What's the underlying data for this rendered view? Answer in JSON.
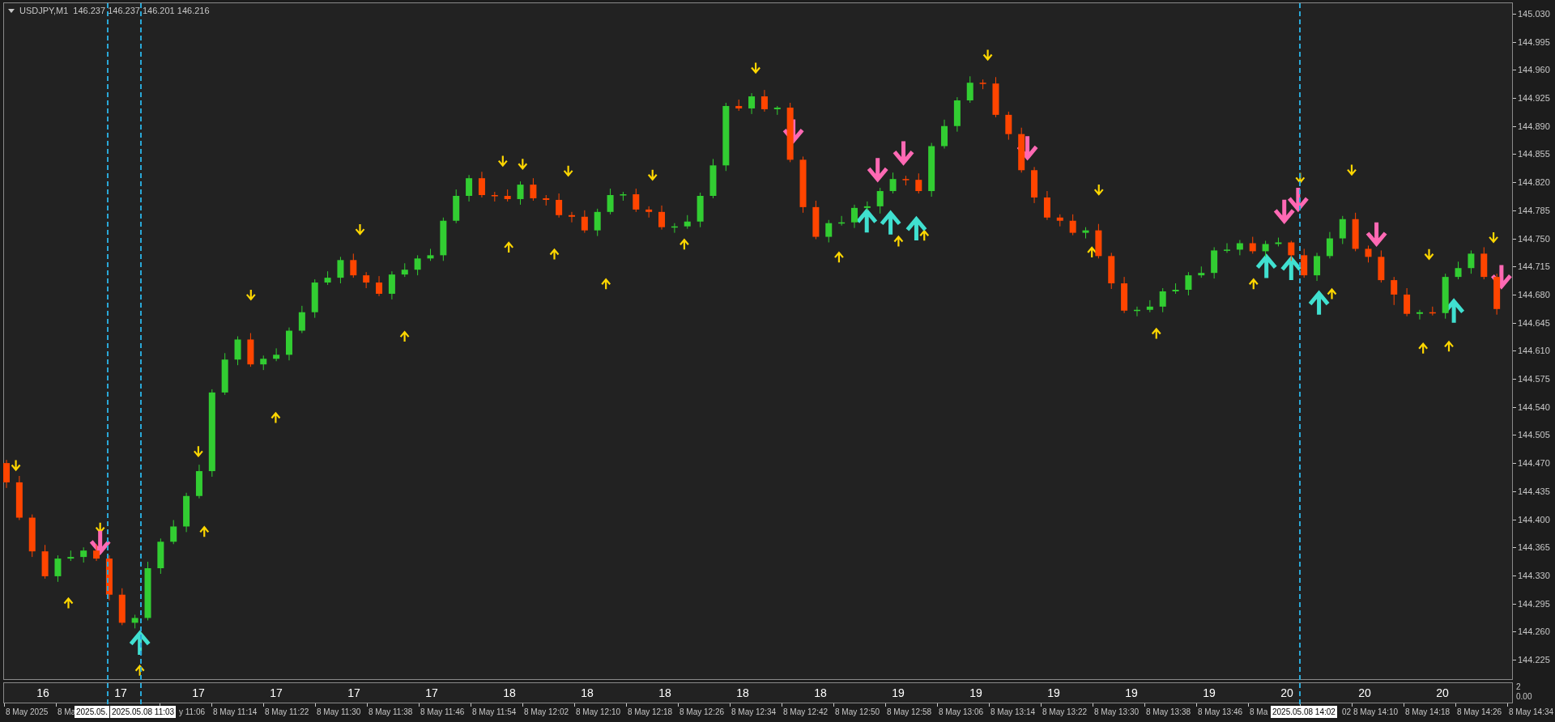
{
  "chart": {
    "symbol": "USDJPY,M1",
    "ohlc": [
      "146.237",
      "146.237",
      "146.201",
      "146.216"
    ],
    "chart_data": {
      "type": "candlestick",
      "ylim": [
        144.1998,
        145.0471
      ],
      "categories": [
        null,
        null,
        null,
        null,
        null,
        null,
        null,
        null,
        null,
        null,
        null,
        null,
        null,
        null,
        null,
        null,
        null,
        null,
        null,
        null,
        null,
        null,
        null,
        null,
        null,
        null,
        null,
        null,
        null,
        null,
        null,
        null,
        null,
        null,
        null,
        null,
        null,
        null,
        null,
        null,
        null,
        null,
        null,
        null,
        null,
        null,
        null,
        null,
        null,
        null,
        null,
        null,
        null,
        null,
        null,
        null,
        null,
        null,
        null,
        null,
        null,
        null,
        null,
        null,
        null,
        null,
        null,
        null,
        null,
        null,
        null,
        null,
        null,
        null,
        null,
        null,
        null,
        null,
        null,
        null,
        null,
        null,
        null,
        null,
        null,
        null,
        null,
        null,
        null,
        null,
        null,
        null,
        null,
        null,
        null,
        null,
        null,
        null,
        null,
        null,
        null,
        null,
        null,
        null,
        null,
        null,
        null,
        null,
        null,
        null,
        null,
        null,
        null,
        null,
        null,
        null,
        null
      ],
      "yticks": [
        {
          "value": 145.03,
          "label": "145.030"
        },
        {
          "value": 144.995,
          "label": "144.995"
        },
        {
          "value": 144.96,
          "label": "144.960"
        },
        {
          "value": 144.925,
          "label": "144.925"
        },
        {
          "value": 144.89,
          "label": "144.890"
        },
        {
          "value": 144.855,
          "label": "144.855"
        },
        {
          "value": 144.82,
          "label": "144.820"
        },
        {
          "value": 144.785,
          "label": "144.785"
        },
        {
          "value": 144.75,
          "label": "144.750"
        },
        {
          "value": 144.715,
          "label": "144.715"
        },
        {
          "value": 144.68,
          "label": "144.680"
        },
        {
          "value": 144.645,
          "label": "144.645"
        },
        {
          "value": 144.61,
          "label": "144.610"
        },
        {
          "value": 144.575,
          "label": "144.575"
        },
        {
          "value": 144.54,
          "label": "144.540"
        },
        {
          "value": 144.505,
          "label": "144.505"
        },
        {
          "value": 144.47,
          "label": "144.470"
        },
        {
          "value": 144.435,
          "label": "144.435"
        },
        {
          "value": 144.4,
          "label": "144.400"
        },
        {
          "value": 144.365,
          "label": "144.365"
        },
        {
          "value": 144.33,
          "label": "144.330"
        },
        {
          "value": 144.295,
          "label": "144.295"
        },
        {
          "value": 144.26,
          "label": "144.260"
        },
        {
          "value": 144.225,
          "label": "144.225"
        }
      ],
      "ohlc": [
        [
          144.47,
          144.474,
          144.439,
          144.446
        ],
        [
          144.446,
          144.454,
          144.399,
          144.402
        ],
        [
          144.402,
          144.406,
          144.353,
          144.36
        ],
        [
          144.36,
          144.368,
          144.326,
          144.329
        ],
        [
          144.329,
          144.355,
          144.322,
          144.351
        ],
        [
          144.351,
          144.361,
          144.348,
          144.353
        ],
        [
          144.353,
          144.365,
          144.346,
          144.361
        ],
        [
          144.361,
          144.369,
          144.348,
          144.351
        ],
        [
          144.351,
          144.355,
          144.299,
          144.306
        ],
        [
          144.306,
          144.314,
          144.268,
          144.271
        ],
        [
          144.271,
          144.281,
          144.264,
          144.277
        ],
        [
          144.277,
          144.347,
          144.274,
          144.339
        ],
        [
          144.339,
          144.376,
          144.332,
          144.372
        ],
        [
          144.372,
          144.399,
          144.369,
          144.391
        ],
        [
          144.391,
          144.433,
          144.384,
          144.429
        ],
        [
          144.429,
          144.468,
          144.426,
          144.46
        ],
        [
          144.46,
          144.562,
          144.453,
          144.558
        ],
        [
          144.558,
          144.607,
          144.555,
          144.599
        ],
        [
          144.599,
          144.628,
          144.592,
          144.624
        ],
        [
          144.624,
          144.632,
          144.59,
          144.593
        ],
        [
          144.593,
          144.604,
          144.586,
          144.6
        ],
        [
          144.6,
          144.613,
          144.597,
          144.605
        ],
        [
          144.605,
          144.639,
          144.598,
          144.635
        ],
        [
          144.635,
          144.666,
          144.632,
          144.658
        ],
        [
          144.658,
          144.699,
          144.651,
          144.695
        ],
        [
          144.695,
          144.709,
          144.692,
          144.701
        ],
        [
          144.701,
          144.727,
          144.694,
          144.723
        ],
        [
          144.723,
          144.731,
          144.701,
          144.704
        ],
        [
          144.704,
          144.708,
          144.688,
          144.695
        ],
        [
          144.695,
          144.703,
          144.678,
          144.681
        ],
        [
          144.681,
          144.709,
          144.674,
          144.705
        ],
        [
          144.705,
          144.719,
          144.702,
          144.711
        ],
        [
          144.711,
          144.729,
          144.704,
          144.725
        ],
        [
          144.725,
          144.737,
          144.722,
          144.729
        ],
        [
          144.729,
          144.776,
          144.722,
          144.772
        ],
        [
          144.772,
          144.811,
          144.769,
          144.803
        ],
        [
          144.803,
          144.829,
          144.796,
          144.825
        ],
        [
          144.825,
          144.833,
          144.801,
          144.804
        ],
        [
          144.804,
          144.808,
          144.796,
          144.803
        ],
        [
          144.803,
          144.811,
          144.796,
          144.799
        ],
        [
          144.799,
          144.821,
          144.792,
          144.817
        ],
        [
          144.817,
          144.825,
          144.797,
          144.8
        ],
        [
          144.8,
          144.804,
          144.791,
          144.798
        ],
        [
          144.798,
          144.806,
          144.776,
          144.779
        ],
        [
          144.779,
          144.783,
          144.77,
          144.777
        ],
        [
          144.777,
          144.785,
          144.757,
          144.76
        ],
        [
          144.76,
          144.787,
          144.753,
          144.783
        ],
        [
          144.783,
          144.812,
          144.78,
          144.804
        ],
        [
          144.804,
          144.808,
          144.797,
          144.805
        ],
        [
          144.805,
          144.812,
          144.783,
          144.786
        ],
        [
          144.786,
          144.79,
          144.776,
          144.783
        ],
        [
          144.783,
          144.791,
          144.761,
          144.764
        ],
        [
          144.764,
          144.769,
          144.757,
          144.765
        ],
        [
          144.765,
          144.779,
          144.762,
          144.771
        ],
        [
          144.771,
          144.807,
          144.764,
          144.803
        ],
        [
          144.803,
          144.849,
          144.8,
          144.841
        ],
        [
          144.841,
          144.919,
          144.834,
          144.915
        ],
        [
          144.915,
          144.923,
          144.909,
          144.912
        ],
        [
          144.912,
          144.931,
          144.905,
          144.927
        ],
        [
          144.927,
          144.935,
          144.908,
          144.911
        ],
        [
          144.911,
          144.915,
          144.904,
          144.913
        ],
        [
          144.913,
          144.919,
          144.845,
          144.848
        ],
        [
          144.848,
          144.852,
          144.782,
          144.789
        ],
        [
          144.789,
          144.797,
          144.749,
          144.752
        ],
        [
          144.752,
          144.773,
          144.745,
          144.769
        ],
        [
          144.769,
          144.778,
          144.766,
          144.77
        ],
        [
          144.77,
          144.792,
          144.763,
          144.788
        ],
        [
          144.788,
          144.796,
          144.785,
          144.79
        ],
        [
          144.79,
          144.813,
          144.781,
          144.809
        ],
        [
          144.809,
          144.832,
          144.806,
          144.824
        ],
        [
          144.824,
          144.828,
          144.816,
          144.823
        ],
        [
          144.823,
          144.831,
          144.806,
          144.809
        ],
        [
          144.809,
          144.869,
          144.802,
          144.865
        ],
        [
          144.865,
          144.898,
          144.862,
          144.89
        ],
        [
          144.89,
          144.926,
          144.883,
          144.922
        ],
        [
          144.922,
          144.952,
          144.919,
          144.944
        ],
        [
          144.944,
          144.948,
          144.936,
          144.943
        ],
        [
          144.943,
          144.951,
          144.901,
          144.904
        ],
        [
          144.904,
          144.908,
          144.873,
          144.88
        ],
        [
          144.88,
          144.888,
          144.832,
          144.835
        ],
        [
          144.835,
          144.839,
          144.794,
          144.801
        ],
        [
          144.801,
          144.809,
          144.773,
          144.776
        ],
        [
          144.776,
          144.78,
          144.765,
          144.772
        ],
        [
          144.772,
          144.78,
          144.754,
          144.757
        ],
        [
          144.757,
          144.764,
          144.75,
          144.76
        ],
        [
          144.76,
          144.768,
          144.725,
          144.728
        ],
        [
          144.728,
          144.732,
          144.687,
          144.694
        ],
        [
          144.694,
          144.702,
          144.657,
          144.66
        ],
        [
          144.66,
          144.665,
          144.653,
          144.661
        ],
        [
          144.661,
          144.673,
          144.658,
          144.665
        ],
        [
          144.665,
          144.688,
          144.658,
          144.684
        ],
        [
          144.684,
          144.694,
          144.681,
          144.686
        ],
        [
          144.686,
          144.708,
          144.679,
          144.704
        ],
        [
          144.704,
          144.715,
          144.701,
          144.707
        ],
        [
          144.707,
          144.739,
          144.7,
          144.735
        ],
        [
          144.735,
          144.744,
          144.732,
          144.736
        ],
        [
          144.736,
          144.748,
          144.729,
          144.744
        ],
        [
          144.744,
          144.752,
          144.731,
          144.734
        ],
        [
          144.734,
          144.747,
          144.727,
          144.743
        ],
        [
          144.743,
          144.751,
          144.74,
          144.745
        ],
        [
          144.745,
          144.747,
          144.722,
          144.729
        ],
        [
          144.729,
          144.737,
          144.701,
          144.704
        ],
        [
          144.704,
          144.732,
          144.697,
          144.728
        ],
        [
          144.728,
          144.758,
          144.725,
          144.75
        ],
        [
          144.75,
          144.778,
          144.743,
          144.774
        ],
        [
          144.774,
          144.782,
          144.734,
          144.737
        ],
        [
          144.737,
          144.741,
          144.72,
          144.727
        ],
        [
          144.727,
          144.735,
          144.695,
          144.698
        ],
        [
          144.698,
          144.702,
          144.667,
          144.68
        ],
        [
          144.68,
          144.688,
          144.653,
          144.656
        ],
        [
          144.656,
          144.661,
          144.649,
          144.658
        ],
        [
          144.658,
          144.665,
          144.654,
          144.657
        ],
        [
          144.657,
          144.706,
          144.65,
          144.702
        ],
        [
          144.702,
          144.721,
          144.699,
          144.713
        ],
        [
          144.713,
          144.735,
          144.706,
          144.731
        ],
        [
          144.731,
          144.739,
          144.699,
          144.702
        ],
        [
          144.702,
          144.706,
          144.655,
          144.662
        ]
      ]
    }
  },
  "subwindow": {
    "day_labels": [
      "16",
      "17",
      "17",
      "17",
      "17",
      "17",
      "18",
      "18",
      "18",
      "18",
      "18",
      "19",
      "19",
      "19",
      "19",
      "19",
      "20",
      "20",
      "20"
    ],
    "scale": [
      "2",
      "0.00"
    ]
  },
  "time_axis": {
    "labels": [
      "8 May 2025",
      "8 Ma",
      "y 11:06",
      "8 May 11:14",
      "8 May 11:22",
      "8 May 11:30",
      "8 May 11:38",
      "8 May 11:46",
      "8 May 11:54",
      "8 May 12:02",
      "8 May 12:10",
      "8 May 12:18",
      "8 May 12:26",
      "8 May 12:34",
      "8 May 12:42",
      "8 May 12:50",
      "8 May 12:58",
      "8 May 13:06",
      "8 May 13:14",
      "8 May 13:22",
      "8 May 13:30",
      "8 May 13:38",
      "8 May 13:46",
      "8 Ma",
      "02",
      "8 May 14:10",
      "8 May 14:18",
      "8 May 14:26",
      "8 May 14:34"
    ],
    "cursor_labels": [
      "2025.05.",
      "2025.05.08 11:03",
      "2025.05.08 14:02"
    ]
  }
}
